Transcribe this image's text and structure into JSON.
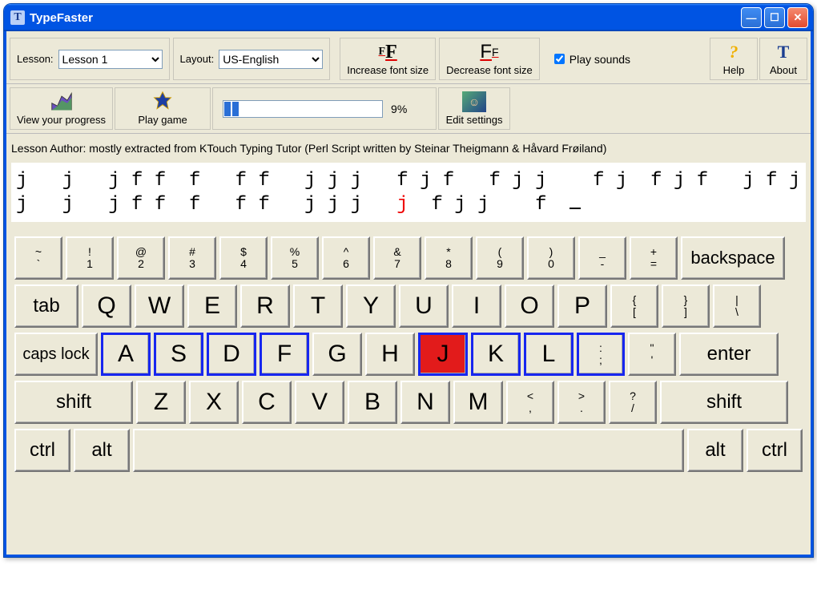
{
  "window": {
    "title": "TypeFaster"
  },
  "toolbar": {
    "lesson_label": "Lesson:",
    "lesson_value": "Lesson 1",
    "layout_label": "Layout:",
    "layout_value": "US-English",
    "increase_font": "Increase font size",
    "decrease_font": "Decrease font size",
    "play_sounds": "Play sounds",
    "help": "Help",
    "about": "About",
    "view_progress": "View your progress",
    "play_game": "Play game",
    "progress_percent": "9%",
    "edit_settings": "Edit settings"
  },
  "author_line": "Lesson Author: mostly extracted from KTouch Typing Tutor (Perl Script written by Steinar Theigmann & Håvard Frøiland)",
  "typing": {
    "line1_left": "j   j   j f f  f   f f   j j j   f j f   f j j    f j  f j f   j f j  ",
    "line1_grey": "j j j",
    "line2_before_red": "j   j   j f f  f   f f   j j j   ",
    "line2_red": "j",
    "line2_after_red": "  f j j    f  ",
    "cursor_pad": ""
  },
  "keyboard": {
    "row1": [
      {
        "top": "~",
        "bot": "`"
      },
      {
        "top": "!",
        "bot": "1"
      },
      {
        "top": "@",
        "bot": "2"
      },
      {
        "top": "#",
        "bot": "3"
      },
      {
        "top": "$",
        "bot": "4"
      },
      {
        "top": "%",
        "bot": "5"
      },
      {
        "top": "^",
        "bot": "6"
      },
      {
        "top": "&",
        "bot": "7"
      },
      {
        "top": "*",
        "bot": "8"
      },
      {
        "top": "(",
        "bot": "9"
      },
      {
        "top": ")",
        "bot": "0"
      },
      {
        "top": "_",
        "bot": "-"
      },
      {
        "top": "+",
        "bot": "="
      }
    ],
    "backspace": "backspace",
    "tab": "tab",
    "row2": [
      "Q",
      "W",
      "E",
      "R",
      "T",
      "Y",
      "U",
      "I",
      "O",
      "P"
    ],
    "row2_punc": [
      {
        "top": "{",
        "bot": "["
      },
      {
        "top": "}",
        "bot": "]"
      },
      {
        "top": "|",
        "bot": "\\"
      }
    ],
    "caps": "caps lock",
    "row3": [
      "A",
      "S",
      "D",
      "F",
      "G",
      "H",
      "J",
      "K",
      "L"
    ],
    "row3_punc": [
      {
        "top": ":",
        "bot": ";"
      },
      {
        "top": "\"",
        "bot": "'"
      }
    ],
    "enter": "enter",
    "shift": "shift",
    "row4": [
      "Z",
      "X",
      "C",
      "V",
      "B",
      "N",
      "M"
    ],
    "row4_punc": [
      {
        "top": "<",
        "bot": ","
      },
      {
        "top": ">",
        "bot": "."
      },
      {
        "top": "?",
        "bot": "/"
      }
    ],
    "ctrl": "ctrl",
    "alt": "alt",
    "home_keys": [
      "A",
      "S",
      "D",
      "F",
      "J",
      "K",
      "L",
      ";"
    ],
    "target_key": "J"
  }
}
